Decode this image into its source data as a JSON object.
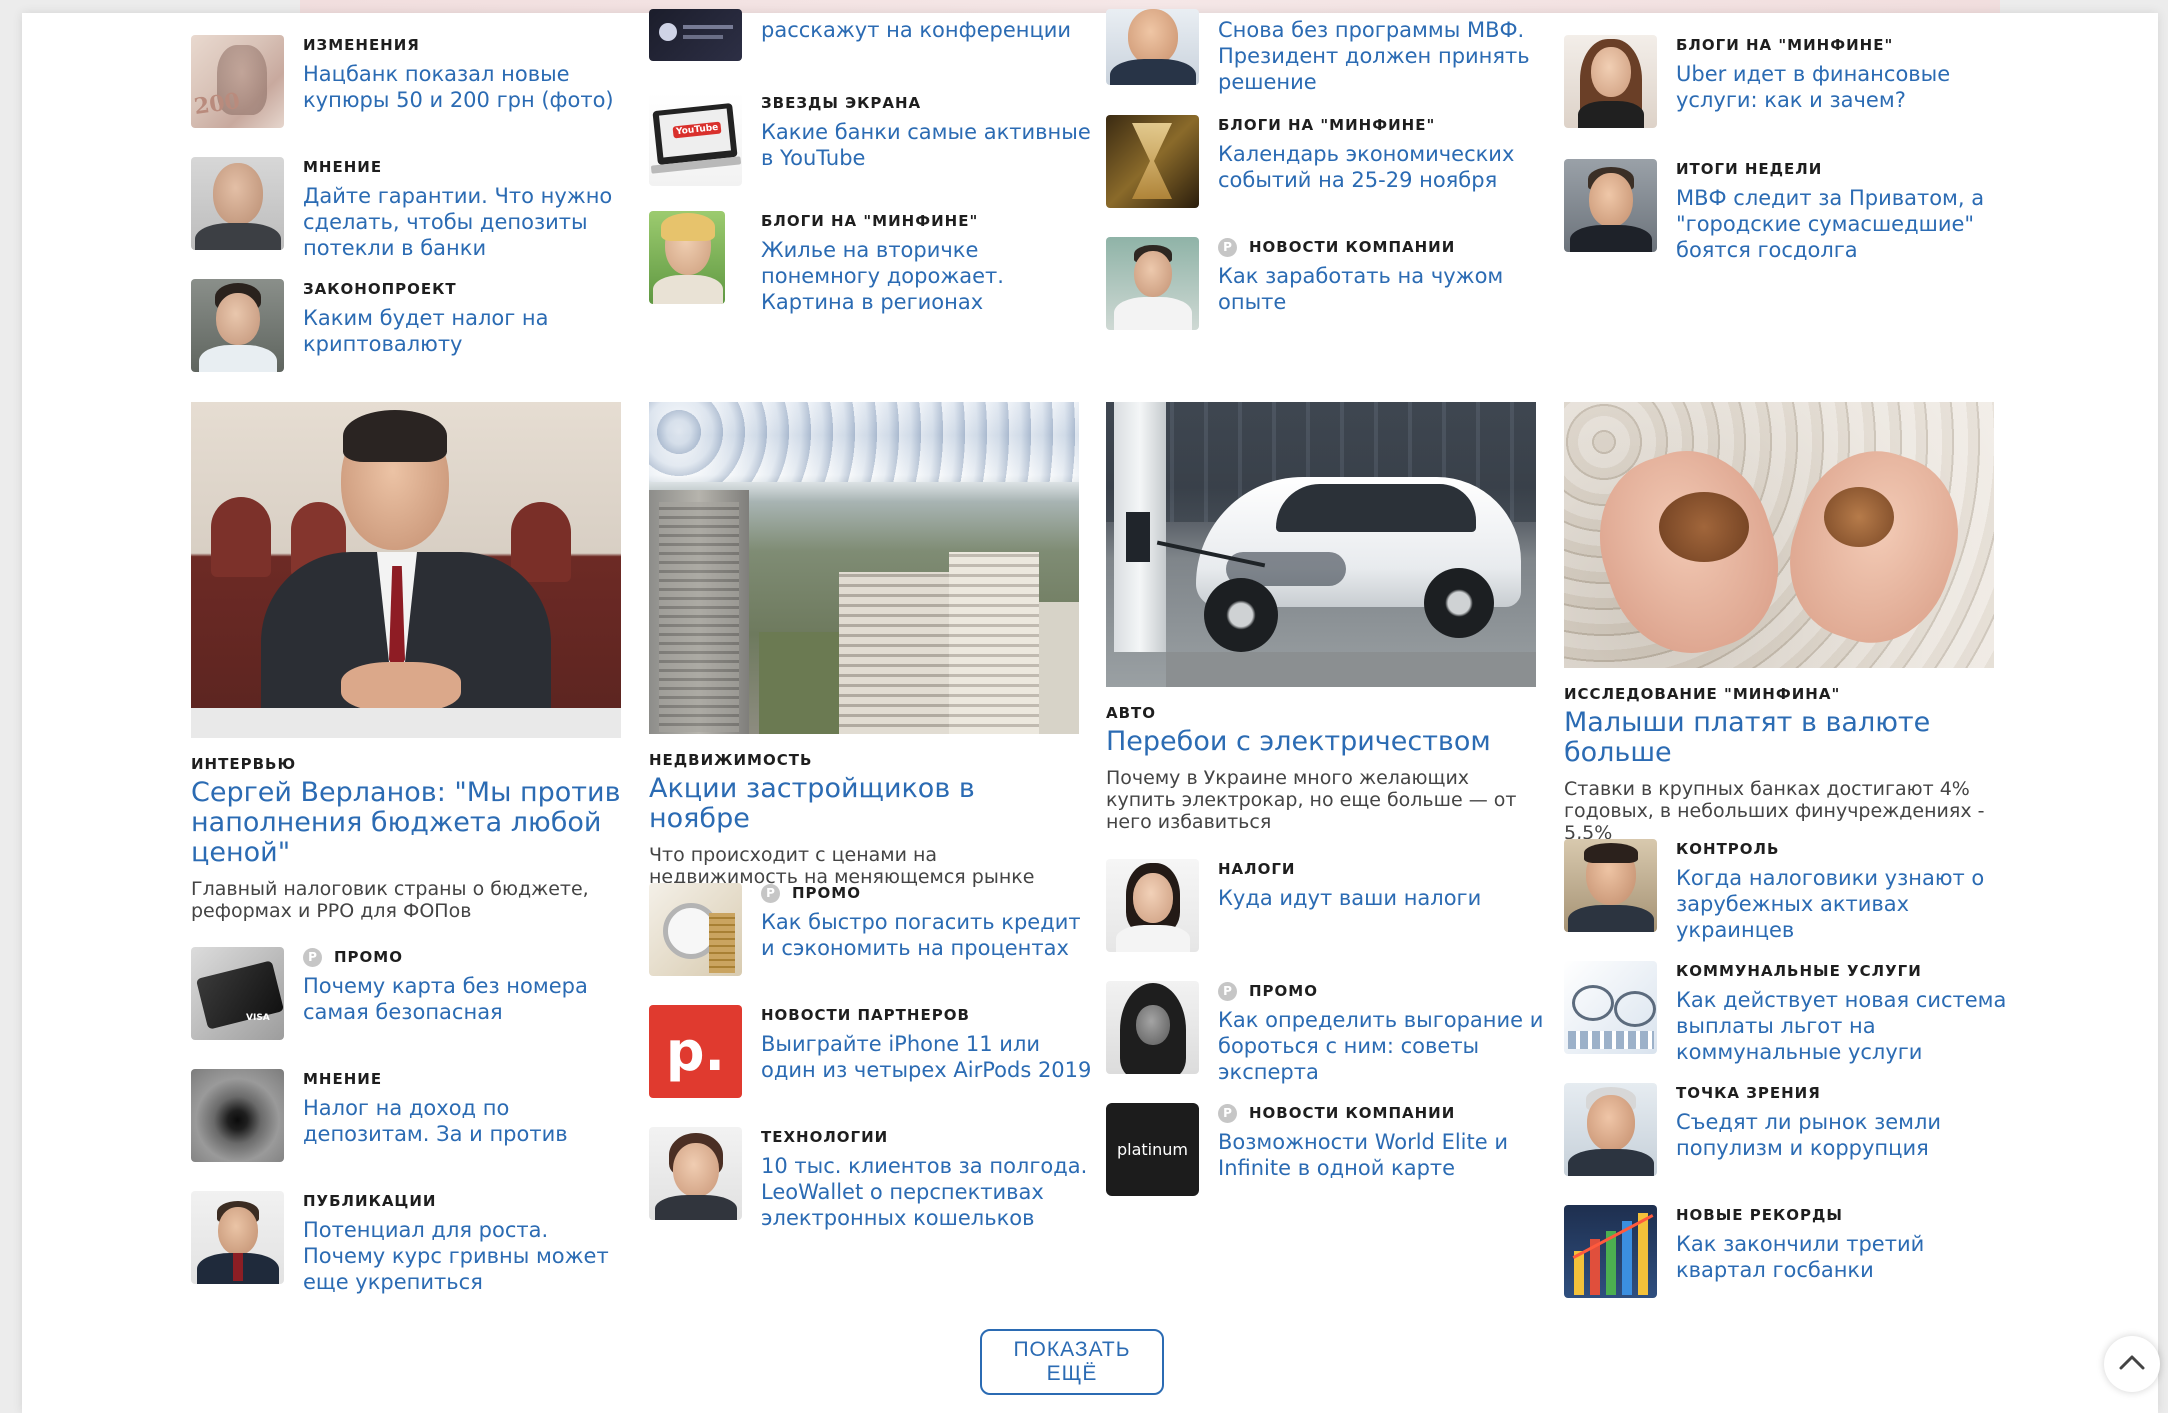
{
  "columns": [
    {
      "top_items": [
        {
          "category": "ИЗМЕНЕНИЯ",
          "title": "Нацбанк показал новые купюры 50 и 200 грн (фото)"
        },
        {
          "category": "МНЕНИЕ",
          "title": "Дайте гарантии. Что нужно сделать, чтобы депозиты потекли в банки"
        },
        {
          "category": "ЗАКОНОПРОЕКТ",
          "title": "Каким будет налог на криптовалюту"
        }
      ],
      "feature": {
        "category": "ИНТЕРВЬЮ",
        "title": "Сергей Верланов: \"Мы против наполнения бюджета любой ценой\"",
        "description": "Главный налоговик страны о бюджете, реформах и РРО для ФОПов"
      },
      "bottom_items": [
        {
          "category": "ПРОМО",
          "title": "Почему карта без номера самая безопасная"
        },
        {
          "category": "МНЕНИЕ",
          "title": "Налог на доход по депозитам. За и против"
        },
        {
          "category": "ПУБЛИКАЦИИ",
          "title": "Потенциал для роста. Почему курс гривны может еще укрепиться"
        }
      ]
    },
    {
      "top_items": [
        {
          "category": "",
          "title": "расскажут на конференции"
        },
        {
          "category": "ЗВЕЗДЫ ЭКРАНА",
          "title": "Какие банки самые активные в YouTube"
        },
        {
          "category": "БЛОГИ НА \"МИНФИНЕ\"",
          "title": "Жилье на вторичке понемногу дорожает. Картина в регионах"
        }
      ],
      "feature": {
        "category": "НЕДВИЖИМОСТЬ",
        "title": "Акции застройщиков в ноябре",
        "description": "Что происходит с ценами на недвижимость на меняющемся рынке"
      },
      "bottom_items": [
        {
          "category": "ПРОМО",
          "title": "Как быстро погасить кредит и сэкономить на процентах"
        },
        {
          "category": "НОВОСТИ ПАРТНЕРОВ",
          "title": "Выиграйте iPhone 11 или один из четырех AirPods 2019"
        },
        {
          "category": "ТЕХНОЛОГИИ",
          "title": "10 тыс. клиентов за полгода. LeoWallet о перспективах электронных кошельков"
        }
      ]
    },
    {
      "top_items": [
        {
          "category": "",
          "title": "Снова без программы МВФ. Президент должен принять решение"
        },
        {
          "category": "БЛОГИ НА \"МИНФИНЕ\"",
          "title": "Календарь экономических событий на 25-29 ноября"
        },
        {
          "category": "НОВОСТИ КОМПАНИИ",
          "title": "Как заработать на чужом опыте"
        }
      ],
      "feature": {
        "category": "АВТО",
        "title": "Перебои с электричеством",
        "description": "Почему в Украине много желающих купить электрокар, но еще больше — от него избавиться"
      },
      "bottom_items": [
        {
          "category": "НАЛОГИ",
          "title": "Куда идут ваши налоги"
        },
        {
          "category": "ПРОМО",
          "title": "Как определить выгорание и бороться с ним: советы эксперта"
        },
        {
          "category": "НОВОСТИ КОМПАНИИ",
          "title": "Возможности World Elite и Infinite в одной карте"
        }
      ]
    },
    {
      "top_items": [
        {
          "category": "БЛОГИ НА \"МИНФИНЕ\"",
          "title": "Uber идет в финансовые услуги: как и зачем?"
        },
        {
          "category": "ИТОГИ НЕДЕЛИ",
          "title": "МВФ следит за Приватом, а \"городские сумасшедшие\" боятся госдолга"
        }
      ],
      "feature": {
        "category": "ИССЛЕДОВАНИЕ \"МИНФИНА\"",
        "title": "Малыши платят в валюте больше",
        "description": "Ставки в крупных банках достигают 4% годовых, в небольших финучреждениях - 5,5%"
      },
      "bottom_items": [
        {
          "category": "КОНТРОЛЬ",
          "title": "Когда налоговики узнают о зарубежных активах украинцев"
        },
        {
          "category": "КОММУНАЛЬНЫЕ УСЛУГИ",
          "title": "Как действует новая система выплаты льгот на коммунальные услуги"
        },
        {
          "category": "ТОЧКА ЗРЕНИЯ",
          "title": "Съедят ли рынок земли популизм и коррупция"
        },
        {
          "category": "НОВЫЕ РЕКОРДЫ",
          "title": "Как закончили третий квартал госбанки"
        }
      ]
    }
  ],
  "thumbnails": {
    "banknote_text": "200",
    "youtube_text": "YouTube",
    "partner_logo_text": "p.",
    "card_logo_text": "platinum",
    "card_brand_text": "VISA"
  },
  "load_more_label": "ПОКАЗАТЬ ЕЩЁ",
  "colors": {
    "link": "#2b6bb3",
    "category": "#1e1e1e",
    "description": "#444444",
    "promo_badge": "#c6c6c6"
  }
}
